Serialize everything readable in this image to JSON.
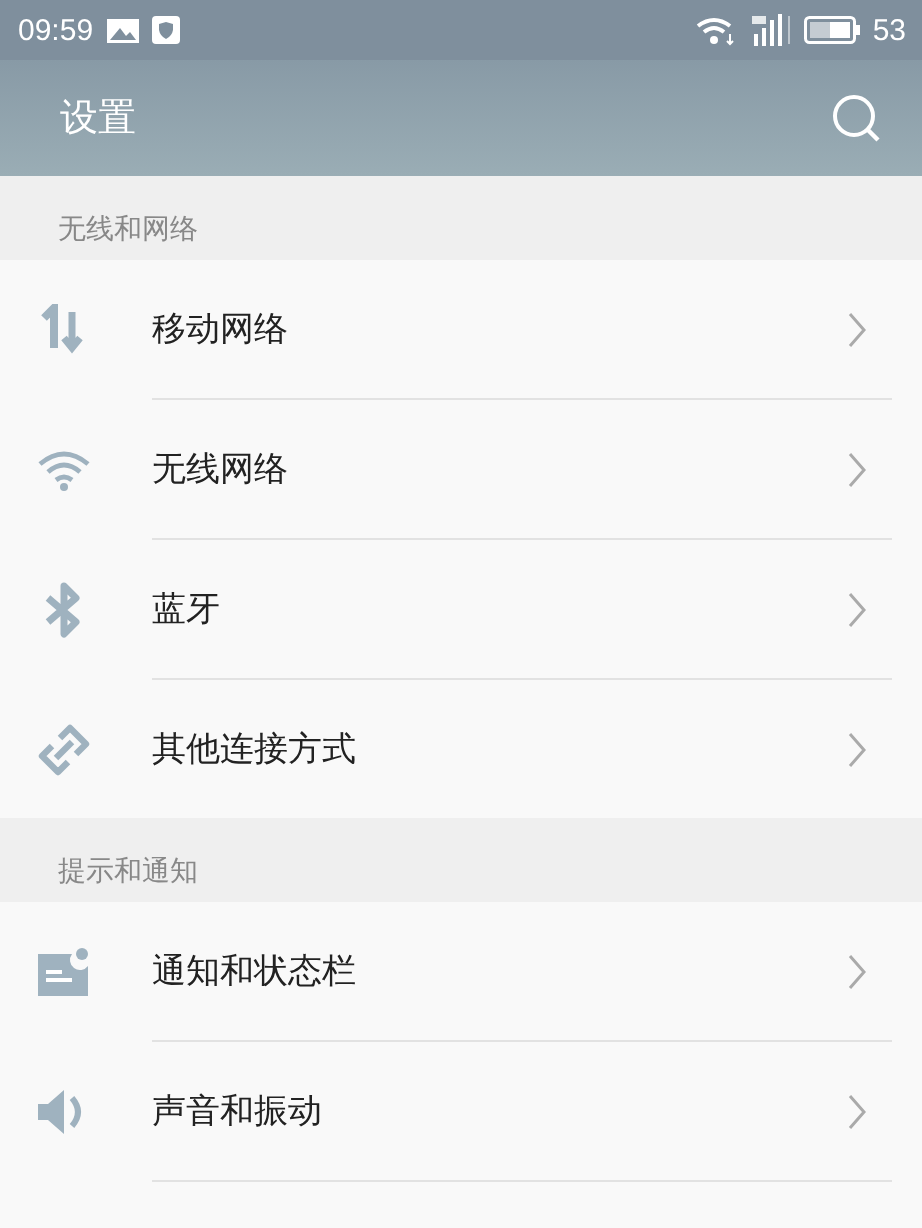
{
  "status_bar": {
    "time": "09:59",
    "battery": "53"
  },
  "app_bar": {
    "title": "设置"
  },
  "sections": [
    {
      "header": "无线和网络",
      "items": [
        {
          "label": "移动网络",
          "kind": "data"
        },
        {
          "label": "无线网络",
          "kind": "wifi"
        },
        {
          "label": "蓝牙",
          "kind": "bluetooth"
        },
        {
          "label": "其他连接方式",
          "kind": "link"
        }
      ]
    },
    {
      "header": "提示和通知",
      "items": [
        {
          "label": "通知和状态栏",
          "kind": "notice"
        },
        {
          "label": "声音和振动",
          "kind": "sound"
        }
      ]
    }
  ]
}
